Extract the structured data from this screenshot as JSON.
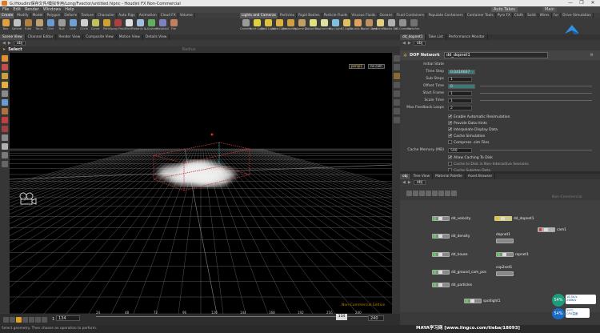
{
  "window": {
    "title": "G:/Houdini保存文件/模拟专用/Long/Fvector/untitled.hipnc - Houdini FX Non-Commercial",
    "controls": [
      "—",
      "❐",
      "✕"
    ]
  },
  "menubar": {
    "items": [
      "File",
      "Edit",
      "Render",
      "Windows",
      "Help"
    ],
    "auto_takes": "Auto Takes",
    "desktop": "Main"
  },
  "shelf_left": {
    "tabs": [
      "Create",
      "Modify",
      "Model",
      "Polygon",
      "Deform",
      "Texture",
      "Character",
      "Auto Rigs",
      "Animation",
      "Cloud FX",
      "Volume"
    ],
    "tools": [
      "Box",
      "Sphere",
      "Tube",
      "Torus",
      "Grid",
      "Null",
      "Line",
      "Circle",
      "Curve",
      "Path",
      "Spray Paint",
      "Font",
      "Platonic S...",
      "L-System",
      "Metaball",
      "File"
    ]
  },
  "shelf_right": {
    "tabs": [
      "Lights and Cameras",
      "Particles",
      "Rigid Bodies",
      "Particle Fluids",
      "Viscous Fluids",
      "Oceans",
      "Fluid Containers",
      "Populate Containers",
      "Container Tools",
      "Pyro FX",
      "Cloth",
      "Solid",
      "Wires",
      "Fur",
      "Drive Simulation"
    ],
    "tools": [
      "Camera",
      "Point Light",
      "Spot Light",
      "Area Light",
      "Geometry...",
      "Volume Li...",
      "Distant Li...",
      "Environme...",
      "Sky Light",
      "GI Light",
      "Caustic Li...",
      "Portal Light",
      "Ambient L...",
      "Stereo Ca...",
      "VR Camera",
      "Switcher"
    ]
  },
  "pane_tabs": [
    "Scene View",
    "Channel Editor",
    "Render View",
    "Composite View",
    "Motion View",
    "Details View"
  ],
  "viewport": {
    "path": "obj",
    "mode": "Select",
    "radius_label": "Radius",
    "camera_label": "persp1",
    "cam_menu": "no cam",
    "watermark": "Non-Commercial Edition"
  },
  "timeline": {
    "start": "1",
    "start_field": "1",
    "current": "134",
    "current_field": "134",
    "end": "240",
    "end_field": "240",
    "ticks": [
      "24",
      "48",
      "72",
      "96",
      "120",
      "144",
      "168",
      "192",
      "216",
      "240"
    ]
  },
  "status": {
    "message": "Select geometry. Then choose an operation to perform.",
    "watermark": "MAYA学习网  [www.lingco.com/tieba/18093]"
  },
  "right_panel": {
    "tabs": [
      "dd_dopnet1",
      "Take List",
      "Performance Monitor"
    ],
    "path": "obj",
    "network_type": "DOP Network",
    "node_name": "dd_dopnet1",
    "params": [
      {
        "label": "Initial State",
        "value": ""
      },
      {
        "label": "Time Step",
        "value": "0.0416667"
      },
      {
        "label": "Sub Steps",
        "value": "1"
      },
      {
        "label": "Offset Time",
        "value": "0"
      },
      {
        "label": "Start Frame",
        "value": "1"
      },
      {
        "label": "Scale Time",
        "value": "1"
      },
      {
        "label": "Max Feedback Loops",
        "value": "2"
      }
    ],
    "checks": [
      {
        "label": "Enable Automatic Resimulation",
        "checked": "✔"
      },
      {
        "label": "Provide Data Hints",
        "checked": "✔"
      },
      {
        "label": "Interpolate Display Data",
        "checked": "✔"
      },
      {
        "label": "Cache Simulation",
        "checked": "✔"
      },
      {
        "label": "Compress .sim Files",
        "checked": ""
      }
    ],
    "cache_memory_label": "Cache Memory (MB)",
    "cache_memory_value": "500",
    "checks2": [
      {
        "label": "Allow Caching To Disk",
        "checked": "✔"
      },
      {
        "label": "Cache to Disk in Non-Interactive Sessions",
        "checked": ""
      },
      {
        "label": "Cache Substep Data",
        "checked": ""
      }
    ]
  },
  "network": {
    "tabs": [
      "obj",
      "Tree View",
      "Material Palette",
      "Asset Browser"
    ],
    "path": "obj",
    "watermark": "Non-Commercial",
    "nodes": [
      "dd_velocity",
      "dd_dopnet1",
      "cam1",
      "dd_density",
      "dopnet1",
      "dd_house",
      "ropnet1",
      "dd_ground_cam_pos",
      "cop2net1",
      "dd_particles",
      "spotlight1"
    ]
  },
  "sysmon": {
    "percent": "54%",
    "temp": "59°C",
    "temp_label": "CPU温度",
    "up": "18.5K/s",
    "down": "248K/s"
  }
}
